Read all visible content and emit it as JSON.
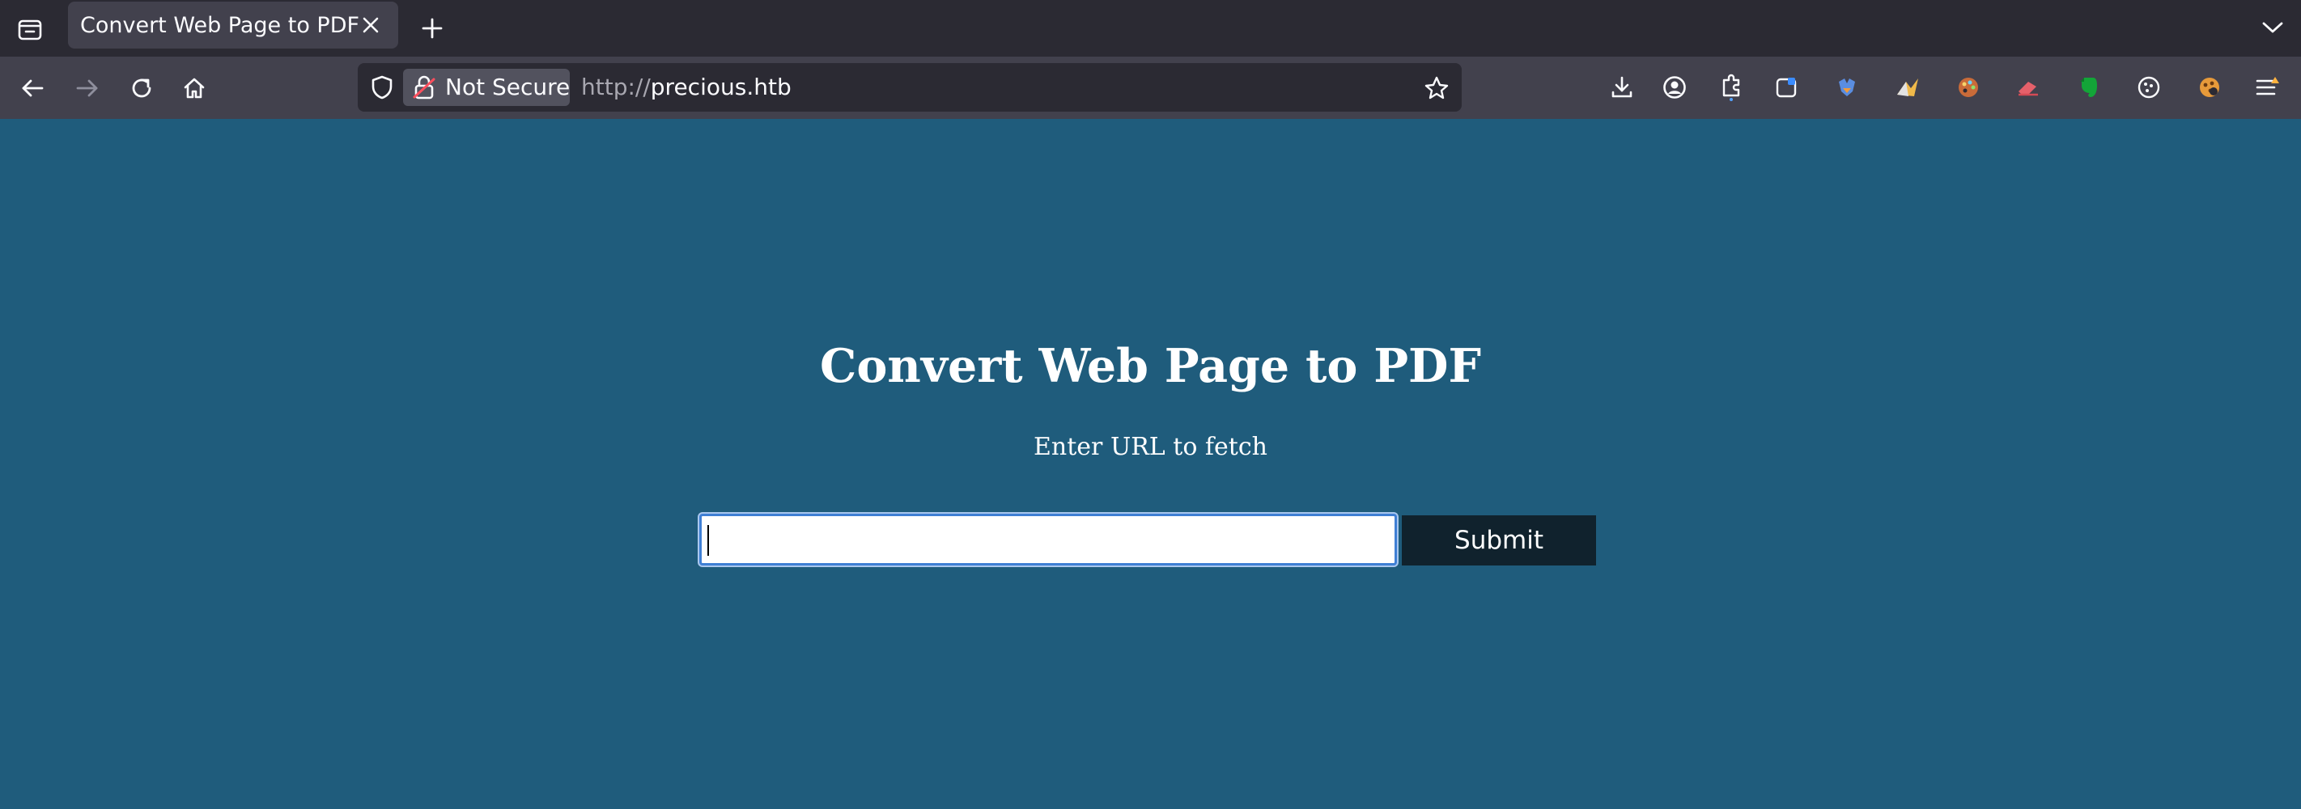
{
  "browser": {
    "tab": {
      "title": "Convert Web Page to PDF"
    },
    "urlbar": {
      "identity_label": "Not Secure",
      "url_scheme": "http://",
      "url_host": "precious.htb"
    },
    "icons": {
      "tab_list": "tab-list-icon",
      "tab_close": "close-icon",
      "new_tab": "plus-icon",
      "tabs_overflow": "chevron-down-icon",
      "back": "arrow-left-icon",
      "forward": "arrow-right-icon",
      "reload": "reload-icon",
      "home": "home-icon",
      "shield": "shield-icon",
      "insecure_lock": "insecure-lock-icon",
      "bookmark": "star-icon",
      "downloads": "download-icon",
      "account": "account-icon",
      "extensions": "puzzle-icon",
      "menu": "hamburger-menu-icon"
    }
  },
  "page": {
    "title": "Convert Web Page to PDF",
    "subtitle": "Enter URL to fetch",
    "url_input": {
      "value": "",
      "placeholder": ""
    },
    "submit_label": "Submit"
  },
  "colors": {
    "page_background": "#1f5c7c",
    "submit_background": "#10222d",
    "toolbar": "#42414d",
    "tab_strip": "#2b2a33",
    "input_focus_ring": "#3f7fd4"
  }
}
